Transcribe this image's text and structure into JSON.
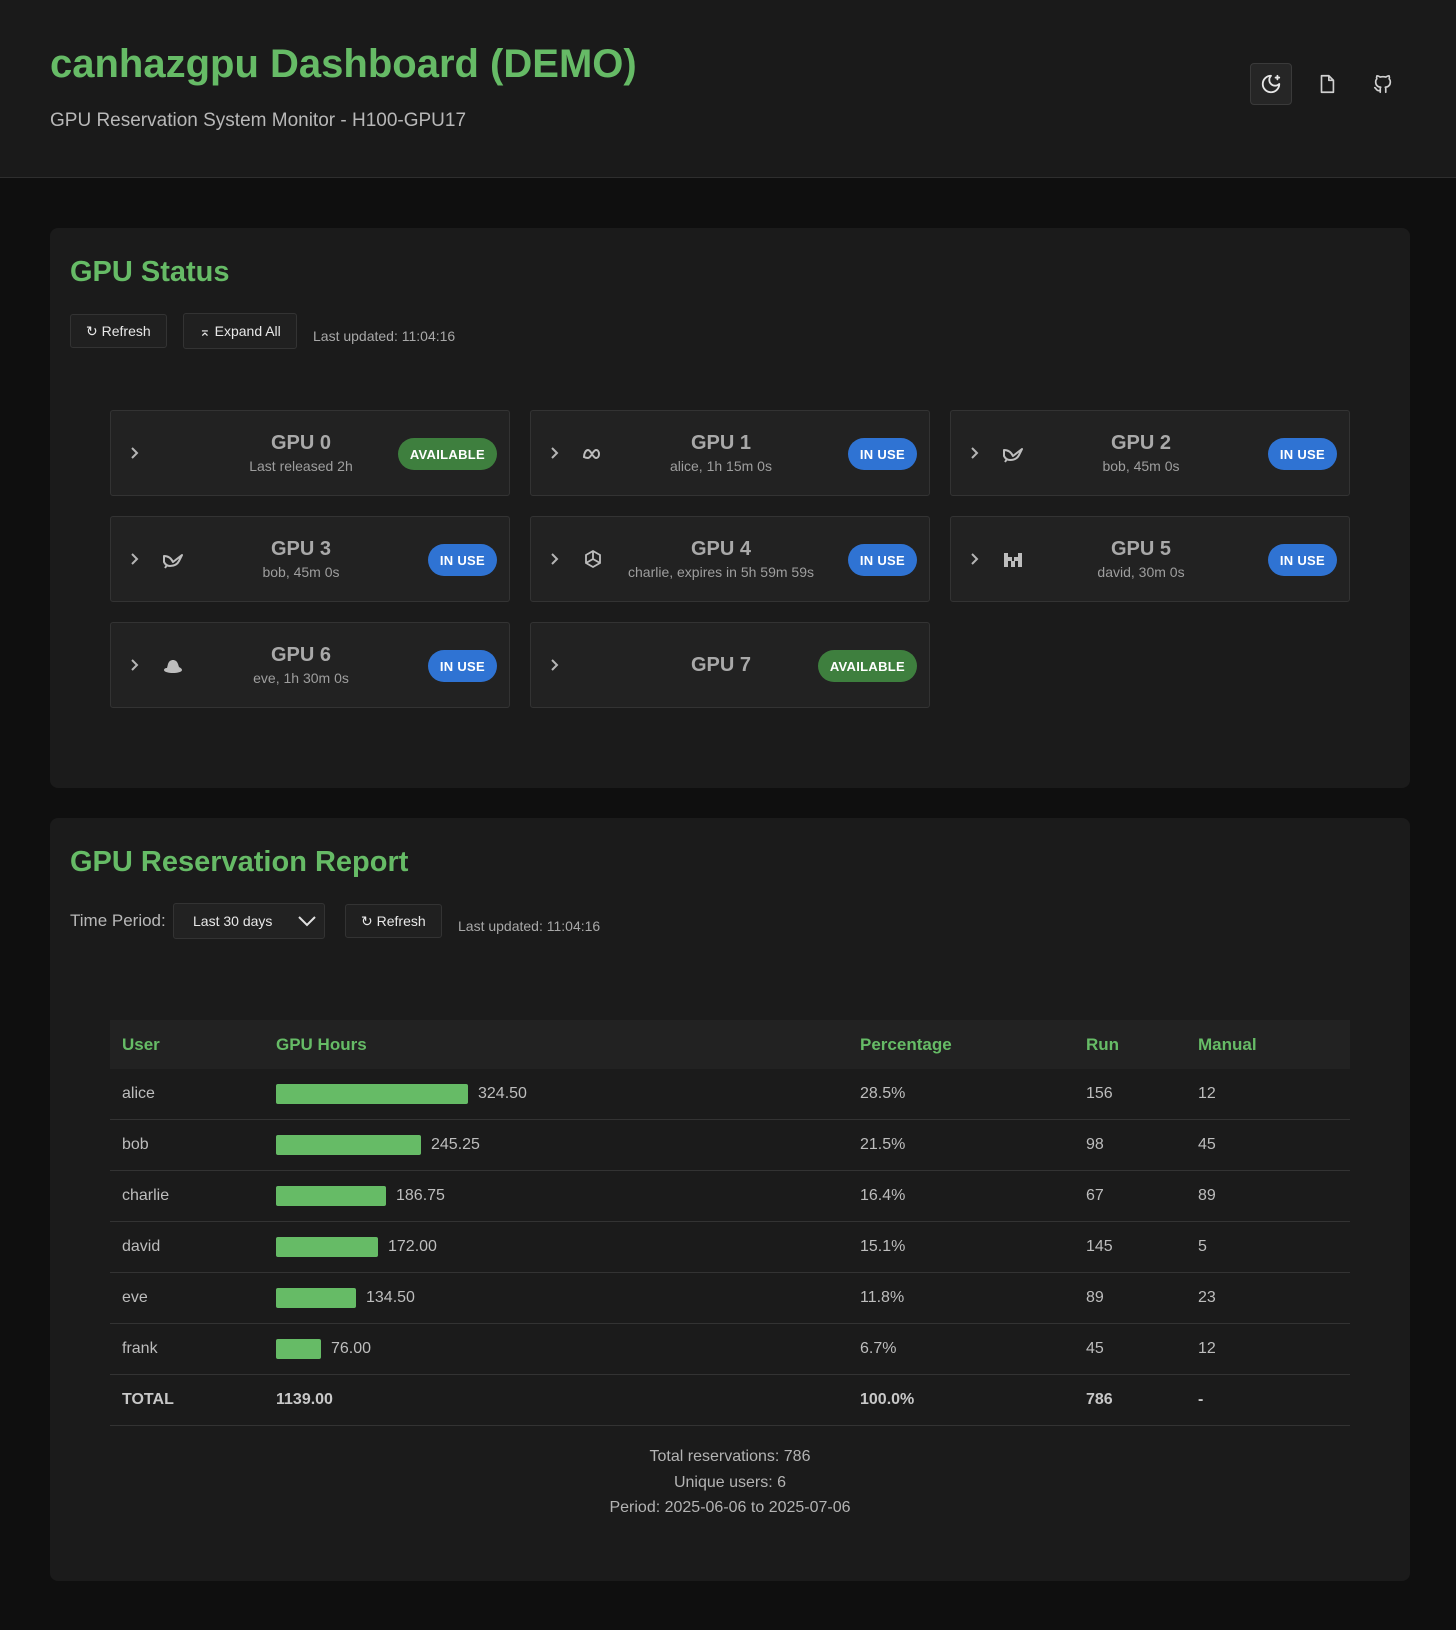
{
  "header": {
    "title": "canhazgpu Dashboard (DEMO)",
    "subtitle": "GPU Reservation System Monitor - H100-GPU17",
    "icons": [
      "theme-toggle-icon",
      "docs-icon",
      "github-icon"
    ]
  },
  "status": {
    "title": "GPU Status",
    "refresh_label": "↻ Refresh",
    "expand_label": "⌅ Expand All",
    "last_updated": "Last updated: 11:04:16",
    "gpus": [
      {
        "name": "GPU 0",
        "info": "Last released 2h",
        "status": "AVAILABLE",
        "icon": ""
      },
      {
        "name": "GPU 1",
        "info": "alice, 1h 15m 0s",
        "status": "IN USE",
        "icon": "meta-icon"
      },
      {
        "name": "GPU 2",
        "info": "bob, 45m 0s",
        "status": "IN USE",
        "icon": "bird-icon"
      },
      {
        "name": "GPU 3",
        "info": "bob, 45m 0s",
        "status": "IN USE",
        "icon": "bird-icon"
      },
      {
        "name": "GPU 4",
        "info": "charlie, expires in 5h 59m 59s",
        "status": "IN USE",
        "icon": "openai-icon"
      },
      {
        "name": "GPU 5",
        "info": "david, 30m 0s",
        "status": "IN USE",
        "icon": "mistral-icon"
      },
      {
        "name": "GPU 6",
        "info": "eve, 1h 30m 0s",
        "status": "IN USE",
        "icon": "redhat-icon"
      },
      {
        "name": "GPU 7",
        "info": "",
        "status": "AVAILABLE",
        "icon": ""
      }
    ]
  },
  "report": {
    "title": "GPU Reservation Report",
    "time_period_label": "Time Period:",
    "time_period_value": "Last 30 days",
    "refresh_label": "↻ Refresh",
    "last_updated": "Last updated: 11:04:16",
    "columns": [
      "User",
      "GPU Hours",
      "Percentage",
      "Run",
      "Manual"
    ],
    "max_hours": 324.5,
    "rows": [
      {
        "user": "alice",
        "hours": 324.5,
        "hours_label": "324.50",
        "pct": "28.5%",
        "run": "156",
        "manual": "12"
      },
      {
        "user": "bob",
        "hours": 245.25,
        "hours_label": "245.25",
        "pct": "21.5%",
        "run": "98",
        "manual": "45"
      },
      {
        "user": "charlie",
        "hours": 186.75,
        "hours_label": "186.75",
        "pct": "16.4%",
        "run": "67",
        "manual": "89"
      },
      {
        "user": "david",
        "hours": 172.0,
        "hours_label": "172.00",
        "pct": "15.1%",
        "run": "145",
        "manual": "5"
      },
      {
        "user": "eve",
        "hours": 134.5,
        "hours_label": "134.50",
        "pct": "11.8%",
        "run": "89",
        "manual": "23"
      },
      {
        "user": "frank",
        "hours": 76.0,
        "hours_label": "76.00",
        "pct": "6.7%",
        "run": "45",
        "manual": "12"
      }
    ],
    "total": {
      "user": "TOTAL",
      "hours": "1139.00",
      "pct": "100.0%",
      "run": "786",
      "manual": "-"
    },
    "summary": {
      "total_reservations": "Total reservations: 786",
      "unique_users": "Unique users: 6",
      "period": "Period: 2025-06-06 to 2025-07-06"
    }
  },
  "colors": {
    "accent": "#66bb66",
    "available": "#3e7f3e",
    "in_use": "#2f73d3"
  }
}
